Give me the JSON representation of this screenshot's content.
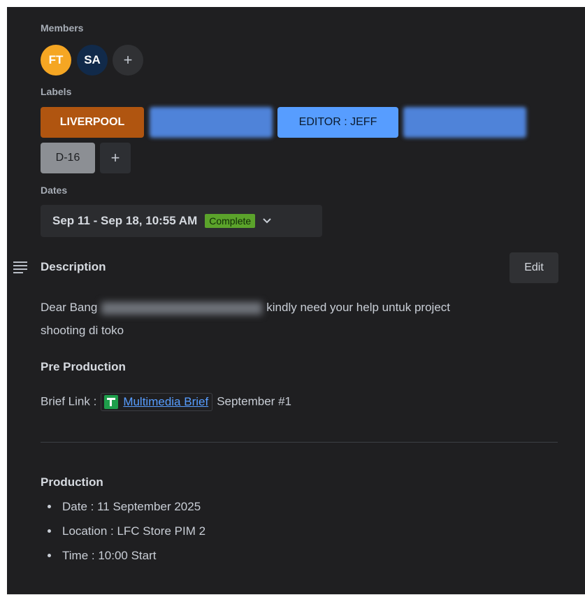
{
  "members": {
    "heading": "Members",
    "avatars": [
      "FT",
      "SA"
    ],
    "add_label": "+"
  },
  "labels": {
    "heading": "Labels",
    "chips": [
      "LIVERPOOL",
      "EDITOR : JEFF",
      "D-16"
    ],
    "add_label": "+"
  },
  "dates": {
    "heading": "Dates",
    "value": "Sep 11 - Sep 18, 10:55 AM",
    "status": "Complete"
  },
  "description": {
    "heading": "Description",
    "edit_label": "Edit",
    "greeting_prefix": "Dear Bang",
    "greeting_suffix": "kindly need your help untuk project",
    "line2": "shooting di toko",
    "pre_production_heading": "Pre Production",
    "brief_prefix": "Brief Link :",
    "brief_link_text": "Multimedia Brief",
    "brief_suffix": "September #1",
    "production_heading": "Production",
    "production_items": [
      "Date : 11 September 2025",
      "Location : LFC Store PIM 2",
      "Time : 10:00 Start"
    ]
  },
  "colors": {
    "panel_bg": "#1f1f21",
    "label_liverpool": "#b05510",
    "label_editor": "#579dff",
    "label_d16": "#8c8f94",
    "complete_badge": "#5ba32b",
    "link": "#579dff"
  },
  "icons": [
    "plus-icon",
    "chevron-down-icon",
    "description-lines-icon",
    "google-sheets-icon"
  ]
}
